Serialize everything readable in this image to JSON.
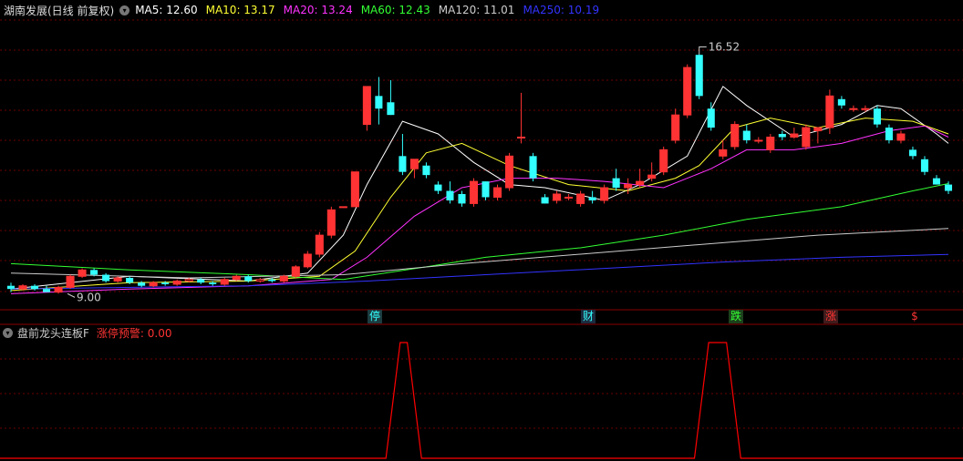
{
  "header": {
    "title": "湖南发展(日线 前复权)",
    "ma": [
      {
        "label": "MA5: 12.60",
        "color": "#ffffff"
      },
      {
        "label": "MA10: 13.17",
        "color": "#ffff33"
      },
      {
        "label": "MA20: 13.24",
        "color": "#ff33ff"
      },
      {
        "label": "MA60: 12.43",
        "color": "#33ff33"
      },
      {
        "label": "MA120: 11.01",
        "color": "#cccccc"
      },
      {
        "label": "MA250: 10.19",
        "color": "#3333ff"
      }
    ]
  },
  "annotations": {
    "high_label": "16.52",
    "low_label": "9.00"
  },
  "events": [
    {
      "label": "停",
      "color": "#33ffff",
      "bg": "#1c3c40"
    },
    {
      "label": "财",
      "color": "#33ffff",
      "bg": "#1c2c40"
    },
    {
      "label": "跌",
      "color": "#33ff33",
      "bg": "#1c401c"
    },
    {
      "label": "涨",
      "color": "#ff3333",
      "bg": "#401c1c"
    },
    {
      "label": "$",
      "color": "#ff3333",
      "bg": ""
    }
  ],
  "sub_panel": {
    "indicator": "盘前龙头连板F",
    "warning_label": "涨停预警: 0.00"
  },
  "colors": {
    "up": "#ff3333",
    "down": "#33ffff",
    "grid": "#6b0000",
    "signal": "#ff0000"
  },
  "chart_data": {
    "type": "candlestick",
    "price_range": [
      8.5,
      17.6
    ],
    "candles": [
      [
        9.2,
        9.1,
        9.3,
        9.0
      ],
      [
        9.1,
        9.2,
        9.25,
        9.05
      ],
      [
        9.2,
        9.1,
        9.25,
        9.05
      ],
      [
        9.1,
        9.0,
        9.2,
        9.0
      ],
      [
        9.0,
        9.15,
        9.2,
        8.95
      ],
      [
        9.15,
        9.5,
        9.55,
        9.1
      ],
      [
        9.5,
        9.7,
        9.75,
        9.45
      ],
      [
        9.7,
        9.55,
        9.75,
        9.5
      ],
      [
        9.55,
        9.35,
        9.6,
        9.3
      ],
      [
        9.35,
        9.45,
        9.5,
        9.3
      ],
      [
        9.45,
        9.3,
        9.5,
        9.25
      ],
      [
        9.3,
        9.2,
        9.35,
        9.15
      ],
      [
        9.2,
        9.3,
        9.35,
        9.15
      ],
      [
        9.3,
        9.25,
        9.35,
        9.2
      ],
      [
        9.25,
        9.35,
        9.4,
        9.2
      ],
      [
        9.35,
        9.4,
        9.45,
        9.3
      ],
      [
        9.4,
        9.3,
        9.45,
        9.25
      ],
      [
        9.3,
        9.25,
        9.35,
        9.2
      ],
      [
        9.25,
        9.4,
        9.45,
        9.2
      ],
      [
        9.4,
        9.5,
        9.55,
        9.35
      ],
      [
        9.5,
        9.35,
        9.55,
        9.3
      ],
      [
        9.35,
        9.4,
        9.45,
        9.3
      ],
      [
        9.4,
        9.35,
        9.45,
        9.3
      ],
      [
        9.35,
        9.5,
        9.55,
        9.3
      ],
      [
        9.5,
        9.8,
        9.85,
        9.45
      ],
      [
        9.8,
        10.2,
        10.3,
        9.75
      ],
      [
        10.2,
        10.8,
        10.9,
        10.1
      ],
      [
        10.8,
        11.6,
        11.7,
        10.7
      ],
      [
        11.7,
        11.7,
        11.7,
        11.7
      ],
      [
        11.7,
        12.8,
        12.8,
        11.7
      ],
      [
        14.3,
        15.5,
        15.5,
        14.1
      ],
      [
        15.2,
        14.8,
        15.8,
        14.3
      ],
      [
        15.0,
        14.6,
        15.7,
        14.6
      ],
      [
        13.3,
        12.8,
        14.0,
        12.7
      ],
      [
        12.9,
        13.2,
        13.2,
        12.6
      ],
      [
        13.0,
        12.7,
        13.1,
        12.6
      ],
      [
        12.4,
        12.2,
        12.5,
        12.1
      ],
      [
        12.2,
        11.9,
        12.5,
        11.8
      ],
      [
        12.1,
        11.8,
        12.2,
        11.7
      ],
      [
        11.8,
        12.5,
        12.6,
        11.7
      ],
      [
        12.5,
        12.0,
        12.5,
        11.9
      ],
      [
        12.0,
        12.3,
        12.4,
        11.9
      ],
      [
        12.3,
        13.3,
        13.4,
        12.2
      ],
      [
        13.9,
        13.9,
        15.3,
        13.7
      ],
      [
        13.3,
        12.6,
        13.4,
        12.5
      ],
      [
        12.0,
        11.8,
        12.1,
        11.8
      ],
      [
        11.9,
        12.1,
        12.2,
        11.8
      ],
      [
        12.0,
        12.0,
        12.1,
        11.9
      ],
      [
        11.8,
        12.1,
        12.2,
        11.7
      ],
      [
        12.0,
        11.9,
        12.2,
        11.8
      ],
      [
        11.9,
        12.3,
        12.4,
        11.8
      ],
      [
        12.6,
        12.3,
        12.9,
        12.2
      ],
      [
        12.3,
        12.4,
        12.6,
        12.1
      ],
      [
        12.4,
        12.5,
        12.9,
        12.3
      ],
      [
        12.6,
        12.7,
        13.1,
        12.5
      ],
      [
        12.8,
        13.5,
        13.6,
        12.7
      ],
      [
        13.8,
        14.6,
        14.8,
        13.7
      ],
      [
        14.6,
        16.1,
        16.2,
        14.5
      ],
      [
        16.5,
        15.2,
        16.52,
        15.1
      ],
      [
        14.8,
        14.2,
        15.0,
        14.1
      ],
      [
        13.3,
        13.5,
        13.8,
        13.2
      ],
      [
        13.6,
        14.3,
        14.4,
        13.5
      ],
      [
        14.1,
        13.8,
        14.3,
        13.7
      ],
      [
        13.8,
        13.8,
        13.9,
        13.7
      ],
      [
        13.5,
        13.9,
        14.0,
        13.4
      ],
      [
        14.0,
        13.9,
        14.1,
        13.8
      ],
      [
        13.9,
        14.0,
        14.2,
        13.85
      ],
      [
        13.6,
        14.2,
        14.3,
        13.5
      ],
      [
        14.1,
        14.2,
        14.2,
        13.7
      ],
      [
        14.2,
        15.2,
        15.4,
        14.0
      ],
      [
        15.1,
        14.9,
        15.2,
        14.8
      ],
      [
        14.8,
        14.8,
        14.9,
        14.7
      ],
      [
        14.8,
        14.8,
        14.9,
        14.7
      ],
      [
        14.8,
        14.3,
        14.9,
        14.2
      ],
      [
        14.2,
        13.8,
        14.3,
        13.7
      ],
      [
        13.8,
        14.0,
        14.1,
        13.7
      ],
      [
        13.5,
        13.3,
        13.6,
        13.2
      ],
      [
        13.2,
        12.8,
        13.3,
        12.7
      ],
      [
        12.6,
        12.4,
        12.7,
        12.4
      ],
      [
        12.4,
        12.2,
        12.5,
        12.1
      ]
    ],
    "ma_lines": [
      {
        "name": "MA5",
        "color": "#ffffff",
        "points": [
          [
            0,
            9.1
          ],
          [
            10,
            9.5
          ],
          [
            20,
            9.35
          ],
          [
            25,
            9.6
          ],
          [
            28,
            10.8
          ],
          [
            30,
            12.4
          ],
          [
            33,
            14.4
          ],
          [
            36,
            14.0
          ],
          [
            39,
            13.1
          ],
          [
            42,
            12.4
          ],
          [
            45,
            12.3
          ],
          [
            50,
            11.9
          ],
          [
            53,
            12.4
          ],
          [
            57,
            13.3
          ],
          [
            60,
            15.5
          ],
          [
            62,
            14.9
          ],
          [
            66,
            13.9
          ],
          [
            70,
            14.3
          ],
          [
            73,
            14.9
          ],
          [
            75,
            14.8
          ],
          [
            78,
            14.0
          ],
          [
            79,
            13.7
          ]
        ]
      },
      {
        "name": "MA10",
        "color": "#ffff33",
        "points": [
          [
            0,
            9.05
          ],
          [
            10,
            9.3
          ],
          [
            20,
            9.35
          ],
          [
            26,
            9.5
          ],
          [
            29,
            10.3
          ],
          [
            32,
            12.0
          ],
          [
            35,
            13.4
          ],
          [
            38,
            13.7
          ],
          [
            42,
            13.0
          ],
          [
            47,
            12.4
          ],
          [
            52,
            12.2
          ],
          [
            56,
            12.6
          ],
          [
            58,
            13.0
          ],
          [
            61,
            14.2
          ],
          [
            64,
            14.5
          ],
          [
            68,
            14.2
          ],
          [
            72,
            14.5
          ],
          [
            76,
            14.4
          ],
          [
            79,
            14.0
          ]
        ]
      },
      {
        "name": "MA20",
        "color": "#ff33ff",
        "points": [
          [
            0,
            8.95
          ],
          [
            10,
            9.1
          ],
          [
            20,
            9.2
          ],
          [
            27,
            9.4
          ],
          [
            30,
            10.1
          ],
          [
            34,
            11.4
          ],
          [
            38,
            12.3
          ],
          [
            42,
            12.6
          ],
          [
            46,
            12.6
          ],
          [
            50,
            12.5
          ],
          [
            55,
            12.3
          ],
          [
            59,
            12.9
          ],
          [
            62,
            13.5
          ],
          [
            66,
            13.5
          ],
          [
            70,
            13.7
          ],
          [
            74,
            14.1
          ],
          [
            77,
            14.25
          ],
          [
            79,
            13.9
          ]
        ]
      },
      {
        "name": "MA60",
        "color": "#33ff33",
        "points": [
          [
            0,
            9.9
          ],
          [
            10,
            9.7
          ],
          [
            20,
            9.55
          ],
          [
            28,
            9.4
          ],
          [
            35,
            9.8
          ],
          [
            40,
            10.1
          ],
          [
            48,
            10.4
          ],
          [
            55,
            10.8
          ],
          [
            62,
            11.3
          ],
          [
            70,
            11.7
          ],
          [
            76,
            12.2
          ],
          [
            79,
            12.43
          ]
        ]
      },
      {
        "name": "MA120",
        "color": "#cccccc",
        "points": [
          [
            0,
            9.6
          ],
          [
            15,
            9.45
          ],
          [
            28,
            9.55
          ],
          [
            38,
            9.9
          ],
          [
            48,
            10.2
          ],
          [
            58,
            10.5
          ],
          [
            68,
            10.8
          ],
          [
            79,
            11.01
          ]
        ]
      },
      {
        "name": "MA250",
        "color": "#3333ff",
        "points": [
          [
            0,
            9.1
          ],
          [
            20,
            9.2
          ],
          [
            30,
            9.35
          ],
          [
            40,
            9.55
          ],
          [
            50,
            9.75
          ],
          [
            60,
            9.95
          ],
          [
            70,
            10.1
          ],
          [
            79,
            10.19
          ]
        ]
      }
    ],
    "signal": {
      "pulses": [
        [
          32.8,
          33.4
        ],
        [
          58.8,
          60.3
        ]
      ]
    }
  }
}
